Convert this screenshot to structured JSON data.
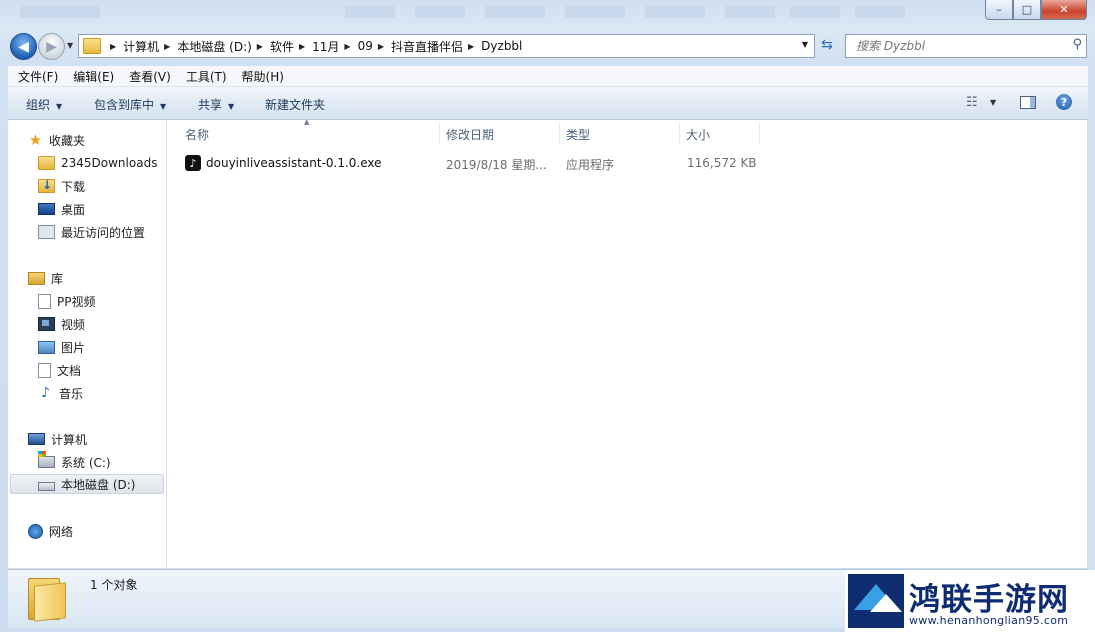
{
  "window": {
    "controls": {
      "minimize": "–",
      "maximize": "□",
      "close": "✕"
    }
  },
  "nav": {
    "back_icon": "left-arrow-icon",
    "forward_icon": "right-arrow-icon",
    "breadcrumbs": [
      "计算机",
      "本地磁盘 (D:)",
      "软件",
      "11月",
      "09",
      "抖音直播伴侣",
      "Dyzbbl"
    ],
    "search_placeholder": "搜索 Dyzbbl"
  },
  "menubar": {
    "items": [
      "文件(F)",
      "编辑(E)",
      "查看(V)",
      "工具(T)",
      "帮助(H)"
    ]
  },
  "toolbar": {
    "organize": "组织",
    "include_in_library": "包含到库中",
    "share": "共享",
    "new_folder": "新建文件夹"
  },
  "sidebar": {
    "favorites": {
      "header": "收藏夹",
      "items": [
        "2345Downloads",
        "下载",
        "桌面",
        "最近访问的位置"
      ]
    },
    "libraries": {
      "header": "库",
      "items": [
        "PP视频",
        "视频",
        "图片",
        "文档",
        "音乐"
      ]
    },
    "computer": {
      "header": "计算机",
      "items": [
        "系统 (C:)",
        "本地磁盘 (D:)"
      ]
    },
    "network": {
      "header": "网络"
    }
  },
  "filelist": {
    "columns": [
      "名称",
      "修改日期",
      "类型",
      "大小"
    ],
    "rows": [
      {
        "name": "douyinliveassistant-0.1.0.exe",
        "modified": "2019/8/18 星期...",
        "type": "应用程序",
        "size": "116,572 KB"
      }
    ]
  },
  "status": {
    "text": "1 个对象"
  },
  "watermark": {
    "title": "鸿联手游网",
    "url": "www.henanhonglian95.com"
  },
  "colors": {
    "accent": "#1f5fb4",
    "watermark": "#0f2c70"
  }
}
